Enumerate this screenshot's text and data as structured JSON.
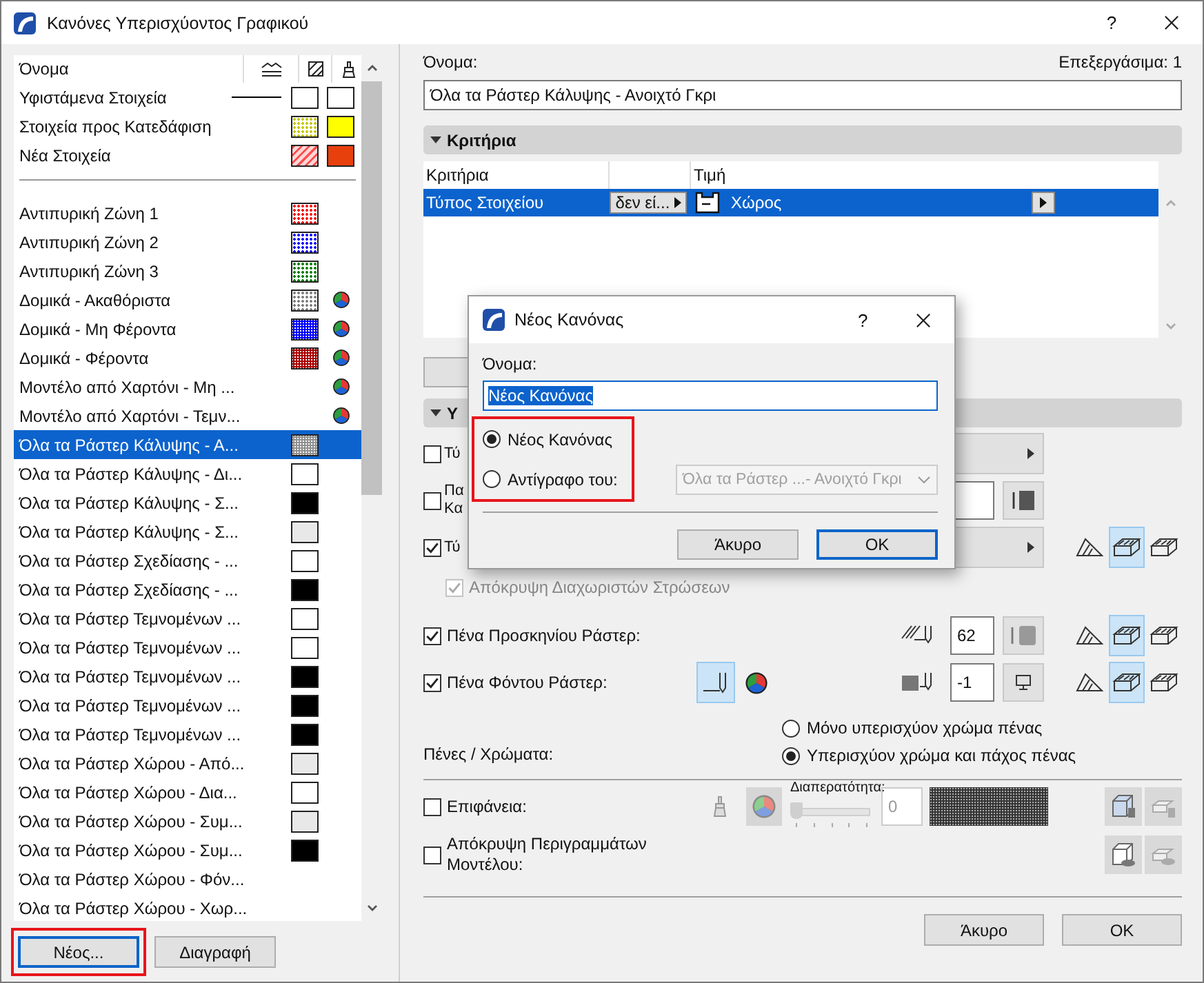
{
  "window": {
    "title": "Κανόνες Υπερισχύοντος Γραφικού",
    "help": "?"
  },
  "list": {
    "header": "Όνομα",
    "status_items": [
      {
        "label": "Υφιστάμενα Στοιχεία",
        "line": true,
        "fill": {
          "color": "#ffffff",
          "kind": "solid"
        },
        "surface": {
          "color": "#ffffff"
        }
      },
      {
        "label": "Στοιχεία προς Κατεδάφιση",
        "line": false,
        "fill": {
          "color": "#c8c800",
          "kind": "dots"
        },
        "surface": {
          "color": "#ffff00"
        }
      },
      {
        "label": "Νέα Στοιχεία",
        "line": false,
        "fill": {
          "color": "#ff5050",
          "kind": "hatch"
        },
        "surface": {
          "color": "#e8400c"
        }
      }
    ],
    "rules": [
      {
        "label": "Αντιπυρική Ζώνη 1",
        "selected": false,
        "fill": {
          "color": "#ff0000",
          "kind": "dots"
        },
        "override_color": false
      },
      {
        "label": "Αντιπυρική Ζώνη 2",
        "selected": false,
        "fill": {
          "color": "#0000ff",
          "kind": "dots"
        },
        "override_color": false
      },
      {
        "label": "Αντιπυρική Ζώνη 3",
        "selected": false,
        "fill": {
          "color": "#008000",
          "kind": "dots"
        },
        "override_color": false
      },
      {
        "label": "Δομικά - Ακαθόριστα",
        "selected": false,
        "fill": {
          "color": "#808080",
          "kind": "dots"
        },
        "override_color": true
      },
      {
        "label": "Δομικά - Μη Φέροντα",
        "selected": false,
        "fill": {
          "color": "#0000ff",
          "kind": "dense"
        },
        "override_color": true
      },
      {
        "label": "Δομικά - Φέροντα",
        "selected": false,
        "fill": {
          "color": "#aa0000",
          "kind": "dense"
        },
        "override_color": true
      },
      {
        "label": "Μοντέλο από Χαρτόνι - Μη ...",
        "selected": false,
        "override_color": true
      },
      {
        "label": "Μοντέλο από Χαρτόνι - Τεμν...",
        "selected": false,
        "override_color": true
      },
      {
        "label": "Όλα τα Ράστερ Κάλυψης - Α...",
        "selected": true,
        "fill": {
          "color": "#909090",
          "kind": "dense"
        },
        "override_color": false
      },
      {
        "label": "Όλα τα Ράστερ Κάλυψης - Δι...",
        "selected": false,
        "fill": {
          "color": "#ffffff",
          "kind": "solid"
        },
        "override_color": false
      },
      {
        "label": "Όλα τα Ράστερ Κάλυψης - Σ...",
        "selected": false,
        "fill": {
          "color": "#000000",
          "kind": "solid"
        },
        "override_color": false
      },
      {
        "label": "Όλα τα Ράστερ Κάλυψης - Σ...",
        "selected": false,
        "fill": {
          "color": "#e8e8e8",
          "kind": "solid"
        },
        "override_color": false
      },
      {
        "label": "Όλα τα Ράστερ Σχεδίασης - ...",
        "selected": false,
        "fill": {
          "color": "#ffffff",
          "kind": "solid"
        },
        "override_color": false
      },
      {
        "label": "Όλα τα Ράστερ Σχεδίασης - ...",
        "selected": false,
        "fill": {
          "color": "#000000",
          "kind": "solid"
        },
        "override_color": false
      },
      {
        "label": "Όλα τα Ράστερ Τεμνομένων ...",
        "selected": false,
        "fill": {
          "color": "#ffffff",
          "kind": "solid"
        },
        "override_color": false
      },
      {
        "label": "Όλα τα Ράστερ Τεμνομένων ...",
        "selected": false,
        "fill": {
          "color": "#ffffff",
          "kind": "solid"
        },
        "override_color": false
      },
      {
        "label": "Όλα τα Ράστερ Τεμνομένων ...",
        "selected": false,
        "fill": {
          "color": "#000000",
          "kind": "solid"
        },
        "override_color": false
      },
      {
        "label": "Όλα τα Ράστερ Τεμνομένων ...",
        "selected": false,
        "fill": {
          "color": "#000000",
          "kind": "solid"
        },
        "override_color": false
      },
      {
        "label": "Όλα τα Ράστερ Τεμνομένων ...",
        "selected": false,
        "fill": {
          "color": "#000000",
          "kind": "solid"
        },
        "override_color": false
      },
      {
        "label": "Όλα τα Ράστερ Χώρου - Από...",
        "selected": false,
        "fill": {
          "color": "#e8e8e8",
          "kind": "solid"
        },
        "override_color": false
      },
      {
        "label": "Όλα τα Ράστερ Χώρου - Δια...",
        "selected": false,
        "fill": {
          "color": "#ffffff",
          "kind": "solid"
        },
        "override_color": false
      },
      {
        "label": "Όλα τα Ράστερ Χώρου - Συμ...",
        "selected": false,
        "fill": {
          "color": "#e8e8e8",
          "kind": "solid"
        },
        "override_color": false
      },
      {
        "label": "Όλα τα Ράστερ Χώρου - Συμ...",
        "selected": false,
        "fill": {
          "color": "#000000",
          "kind": "solid"
        },
        "override_color": false
      },
      {
        "label": "Όλα τα Ράστερ Χώρου - Φόν...",
        "selected": false,
        "override_color": false
      },
      {
        "label": "Όλα τα Ράστερ Χώρου - Χωρ...",
        "selected": false,
        "override_color": false
      }
    ]
  },
  "list_buttons": [
    {
      "label": "Νέος...",
      "default": true,
      "highlighted": true
    },
    {
      "label": "Διαγραφή",
      "default": false,
      "highlighted": false
    }
  ],
  "detail": {
    "name_label": "Όνομα:",
    "editable": "Επεξεργάσιμα: 1",
    "name_value": "Όλα τα Ράστερ Κάλυψης - Ανοιχτό Γκρι",
    "criteria": {
      "title": "Κριτήρια",
      "expanded": true,
      "columns": [
        "Κριτήρια",
        "Τιμή"
      ],
      "rows": [
        {
          "criterion": "Τύπος Στοιχείου",
          "operator": "δεν εί...",
          "value": "Χώρος",
          "selected": true
        }
      ]
    },
    "overrides": {
      "title": "Υ",
      "expanded": true,
      "rows": [
        {
          "kind": "dropdown",
          "label": "Τύ",
          "checked": false
        },
        {
          "kind": "pattern",
          "label": "Πα Κα",
          "checked": false
        },
        {
          "kind": "dropdown-views",
          "label": "Τύ",
          "checked": true,
          "views": [
            {
              "selected": false
            },
            {
              "selected": true
            },
            {
              "selected": false
            }
          ]
        },
        {
          "kind": "sub",
          "label": "Απόκρυψη Διαχωριστών Στρώσεων",
          "checked": true,
          "disabled": true
        },
        {
          "kind": "pen",
          "label": "Πένα Προσκηνίου Ράστερ:",
          "checked": true,
          "pen_icon": {
            "kind": "hatch"
          },
          "pen": "62",
          "override_color": false,
          "views": [
            {
              "selected": false
            },
            {
              "selected": true
            },
            {
              "selected": false
            }
          ]
        },
        {
          "kind": "pen",
          "label": "Πένα Φόντου Ράστερ:",
          "checked": true,
          "pen_icon": {
            "kind": "solid"
          },
          "pen": "-1",
          "override_color": true,
          "views": [
            {
              "selected": false
            },
            {
              "selected": true
            },
            {
              "selected": false
            }
          ]
        },
        {
          "kind": "radios",
          "label": "Πένες / Χρώματα:",
          "options": [
            {
              "label": "Μόνο υπερισχύον χρώμα πένας",
              "selected": false
            },
            {
              "label": "Υπερισχύον χρώμα και πάχος πένας",
              "selected": true
            }
          ]
        },
        {
          "kind": "surface",
          "label": "Επιφάνεια:",
          "checked": false,
          "transparency_label": "Διαπερατότητα:",
          "transparency": "0",
          "level": 0
        },
        {
          "kind": "contours",
          "label": "Απόκρυψη Περιγραμμάτων Μοντέλου:",
          "checked": false
        }
      ]
    },
    "buttons": [
      {
        "label": "Άκυρο",
        "default": false
      },
      {
        "label": "OK",
        "default": false
      }
    ]
  },
  "modal": {
    "title": "Νέος Κανόνας",
    "help": "?",
    "name_label": "Όνομα:",
    "name_value": "Νέος Κανόνας",
    "highlighted": true,
    "options": [
      {
        "label": "Νέος Κανόνας",
        "selected": true
      },
      {
        "label": "Αντίγραφο του:",
        "selected": false
      }
    ],
    "copy_source": "Όλα τα Ράστερ ...- Ανοιχτό Γκρι",
    "buttons": [
      {
        "label": "Άκυρο",
        "default": false
      },
      {
        "label": "OK",
        "default": true
      }
    ]
  }
}
